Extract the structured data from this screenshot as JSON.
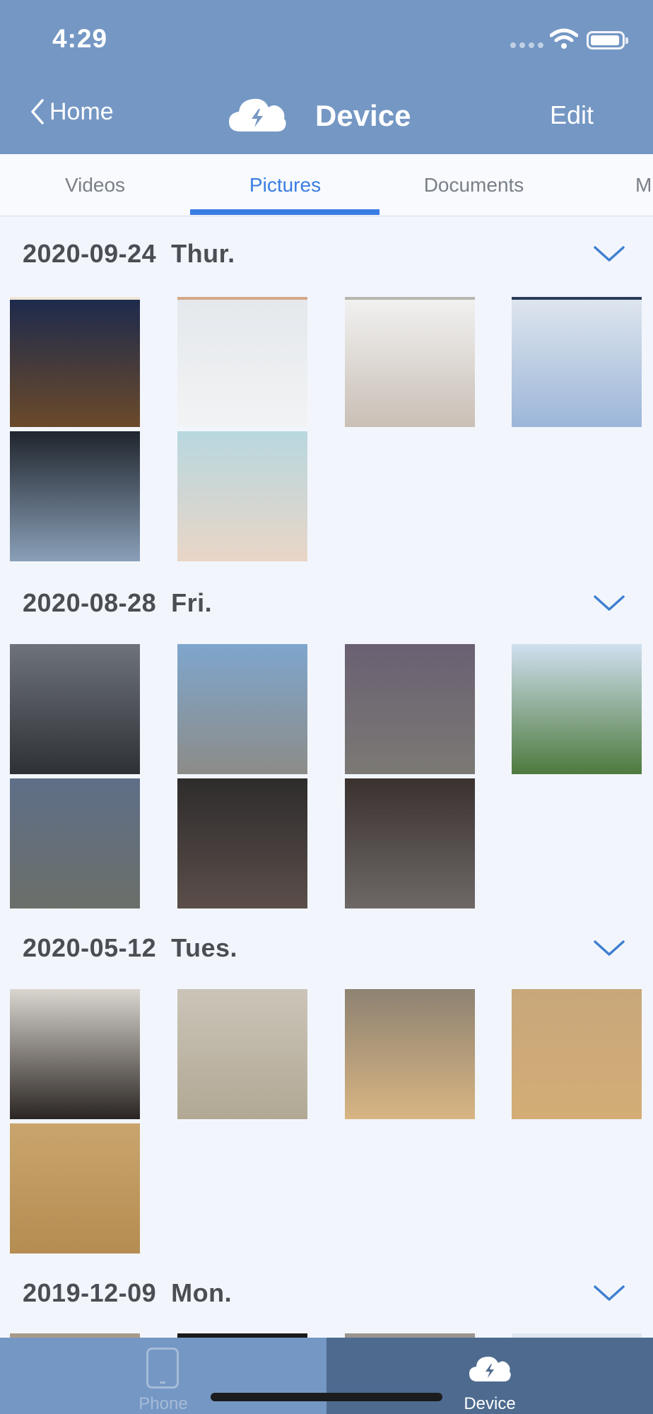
{
  "status_bar": {
    "time": "4:29"
  },
  "nav": {
    "back_label": "Home",
    "title": "Device",
    "edit_label": "Edit"
  },
  "tabs": [
    "Videos",
    "Pictures",
    "Documents",
    "M"
  ],
  "active_tab": "Pictures",
  "sections": [
    {
      "date": "2020-09-24  Thur.",
      "photos": [
        {
          "top": "#1c2a4d",
          "bottom": "#6b4a2a",
          "bar": "#f0e6d8"
        },
        {
          "top": "#e4e8ec",
          "bottom": "#f2f3f4",
          "bar": "#d4a888"
        },
        {
          "top": "#f2f2f2",
          "bottom": "#c9bfb5",
          "bar": "#b8b4ae"
        },
        {
          "top": "#dfe6ee",
          "bottom": "#9cb6d9",
          "bar": "#2a3b5a"
        },
        {
          "top": "#20252d",
          "bottom": "#8aa0b8"
        },
        {
          "top": "#b8d7df",
          "bottom": "#e9d6c7"
        }
      ]
    },
    {
      "date": "2020-08-28  Fri.",
      "photos": [
        {
          "top": "#6e737a",
          "bottom": "#2e3237"
        },
        {
          "top": "#7fa6cd",
          "bottom": "#8c8c88"
        },
        {
          "top": "#6a6072",
          "bottom": "#7b7975"
        },
        {
          "top": "#cfe0ef",
          "bottom": "#4e7a3e"
        },
        {
          "top": "#5f6f88",
          "bottom": "#6b6f6a"
        },
        {
          "top": "#2e2c2c",
          "bottom": "#5b4e4a"
        },
        {
          "top": "#3b3230",
          "bottom": "#6d6866"
        }
      ]
    },
    {
      "date": "2020-05-12  Tues.",
      "photos": [
        {
          "top": "#d9d5cf",
          "bottom": "#2a2522"
        },
        {
          "top": "#cbc4b8",
          "bottom": "#b1a894"
        },
        {
          "top": "#8e8272",
          "bottom": "#d8b582"
        },
        {
          "top": "#c8a77b",
          "bottom": "#d3ad75"
        },
        {
          "top": "#c9a56d",
          "bottom": "#b58c52"
        }
      ]
    },
    {
      "date": "2019-12-09  Mon.",
      "photos": [
        {
          "top": "#a89a8a",
          "bottom": "#a89a8a"
        },
        {
          "top": "#1a1a1a",
          "bottom": "#1a1a1a"
        },
        {
          "top": "#9a9590",
          "bottom": "#9a9590"
        },
        {
          "top": "#dfe8f2",
          "bottom": "#dfe8f2"
        }
      ]
    }
  ],
  "bottom_tabs": [
    {
      "label": "Phone"
    },
    {
      "label": "Device"
    }
  ],
  "active_bottom_tab": "Device",
  "colors": {
    "header": "#7597c4",
    "accent": "#3a7de3",
    "background": "#f2f6fc",
    "active_bottom": "#4e6b8f"
  }
}
